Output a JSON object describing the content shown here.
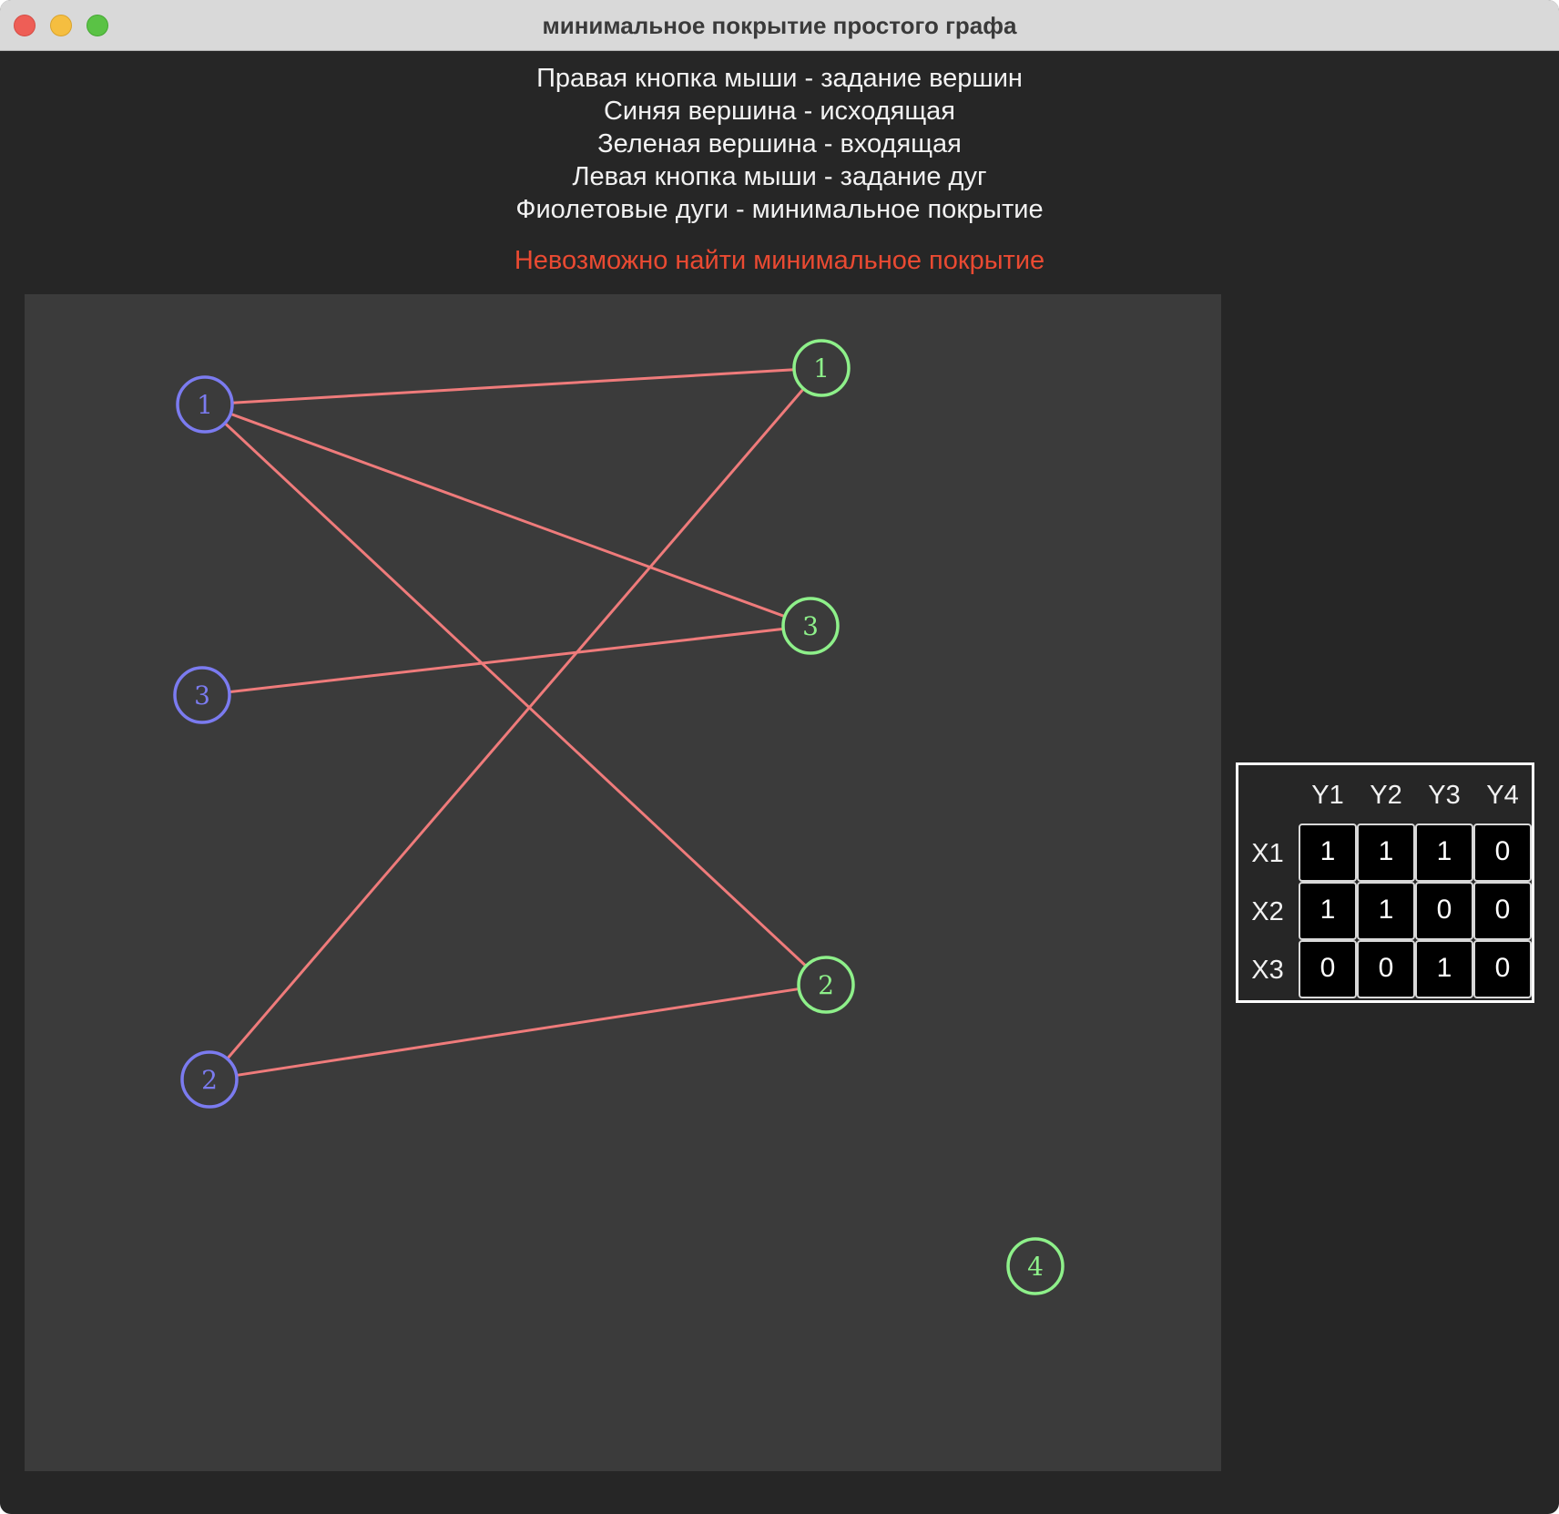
{
  "window": {
    "title": "минимальное покрытие простого графа"
  },
  "instructions": [
    "Правая кнопка мыши - задание вершин",
    "Синяя вершина - исходящая",
    "Зеленая вершина - входящая",
    "Левая кнопка мыши - задание дуг",
    "Фиолетовые дуги - минимальное покрытие"
  ],
  "error_message": "Невозможно найти минимальное покрытие",
  "colors": {
    "source_vertex": "#7b7bf0",
    "target_vertex": "#8ef08a",
    "edge": "#ef7b7b",
    "error_text": "#ea4a32",
    "canvas_bg": "#3b3b3b",
    "window_bg": "#262626"
  },
  "graph": {
    "source_vertices": [
      {
        "id": "X1",
        "label": "1"
      },
      {
        "id": "X3",
        "label": "3"
      },
      {
        "id": "X2",
        "label": "2"
      }
    ],
    "target_vertices": [
      {
        "id": "Y1",
        "label": "1"
      },
      {
        "id": "Y3",
        "label": "3"
      },
      {
        "id": "Y2",
        "label": "2"
      },
      {
        "id": "Y4",
        "label": "4"
      }
    ],
    "edges": [
      {
        "from": "X1",
        "to": "Y1"
      },
      {
        "from": "X1",
        "to": "Y3"
      },
      {
        "from": "X1",
        "to": "Y2"
      },
      {
        "from": "X3",
        "to": "Y3"
      },
      {
        "from": "X2",
        "to": "Y1"
      },
      {
        "from": "X2",
        "to": "Y2"
      }
    ]
  },
  "matrix": {
    "col_headers": [
      "Y1",
      "Y2",
      "Y3",
      "Y4"
    ],
    "row_headers": [
      "X1",
      "X2",
      "X3"
    ],
    "rows": [
      [
        "1",
        "1",
        "1",
        "0"
      ],
      [
        "1",
        "1",
        "0",
        "0"
      ],
      [
        "0",
        "0",
        "1",
        "0"
      ]
    ]
  }
}
